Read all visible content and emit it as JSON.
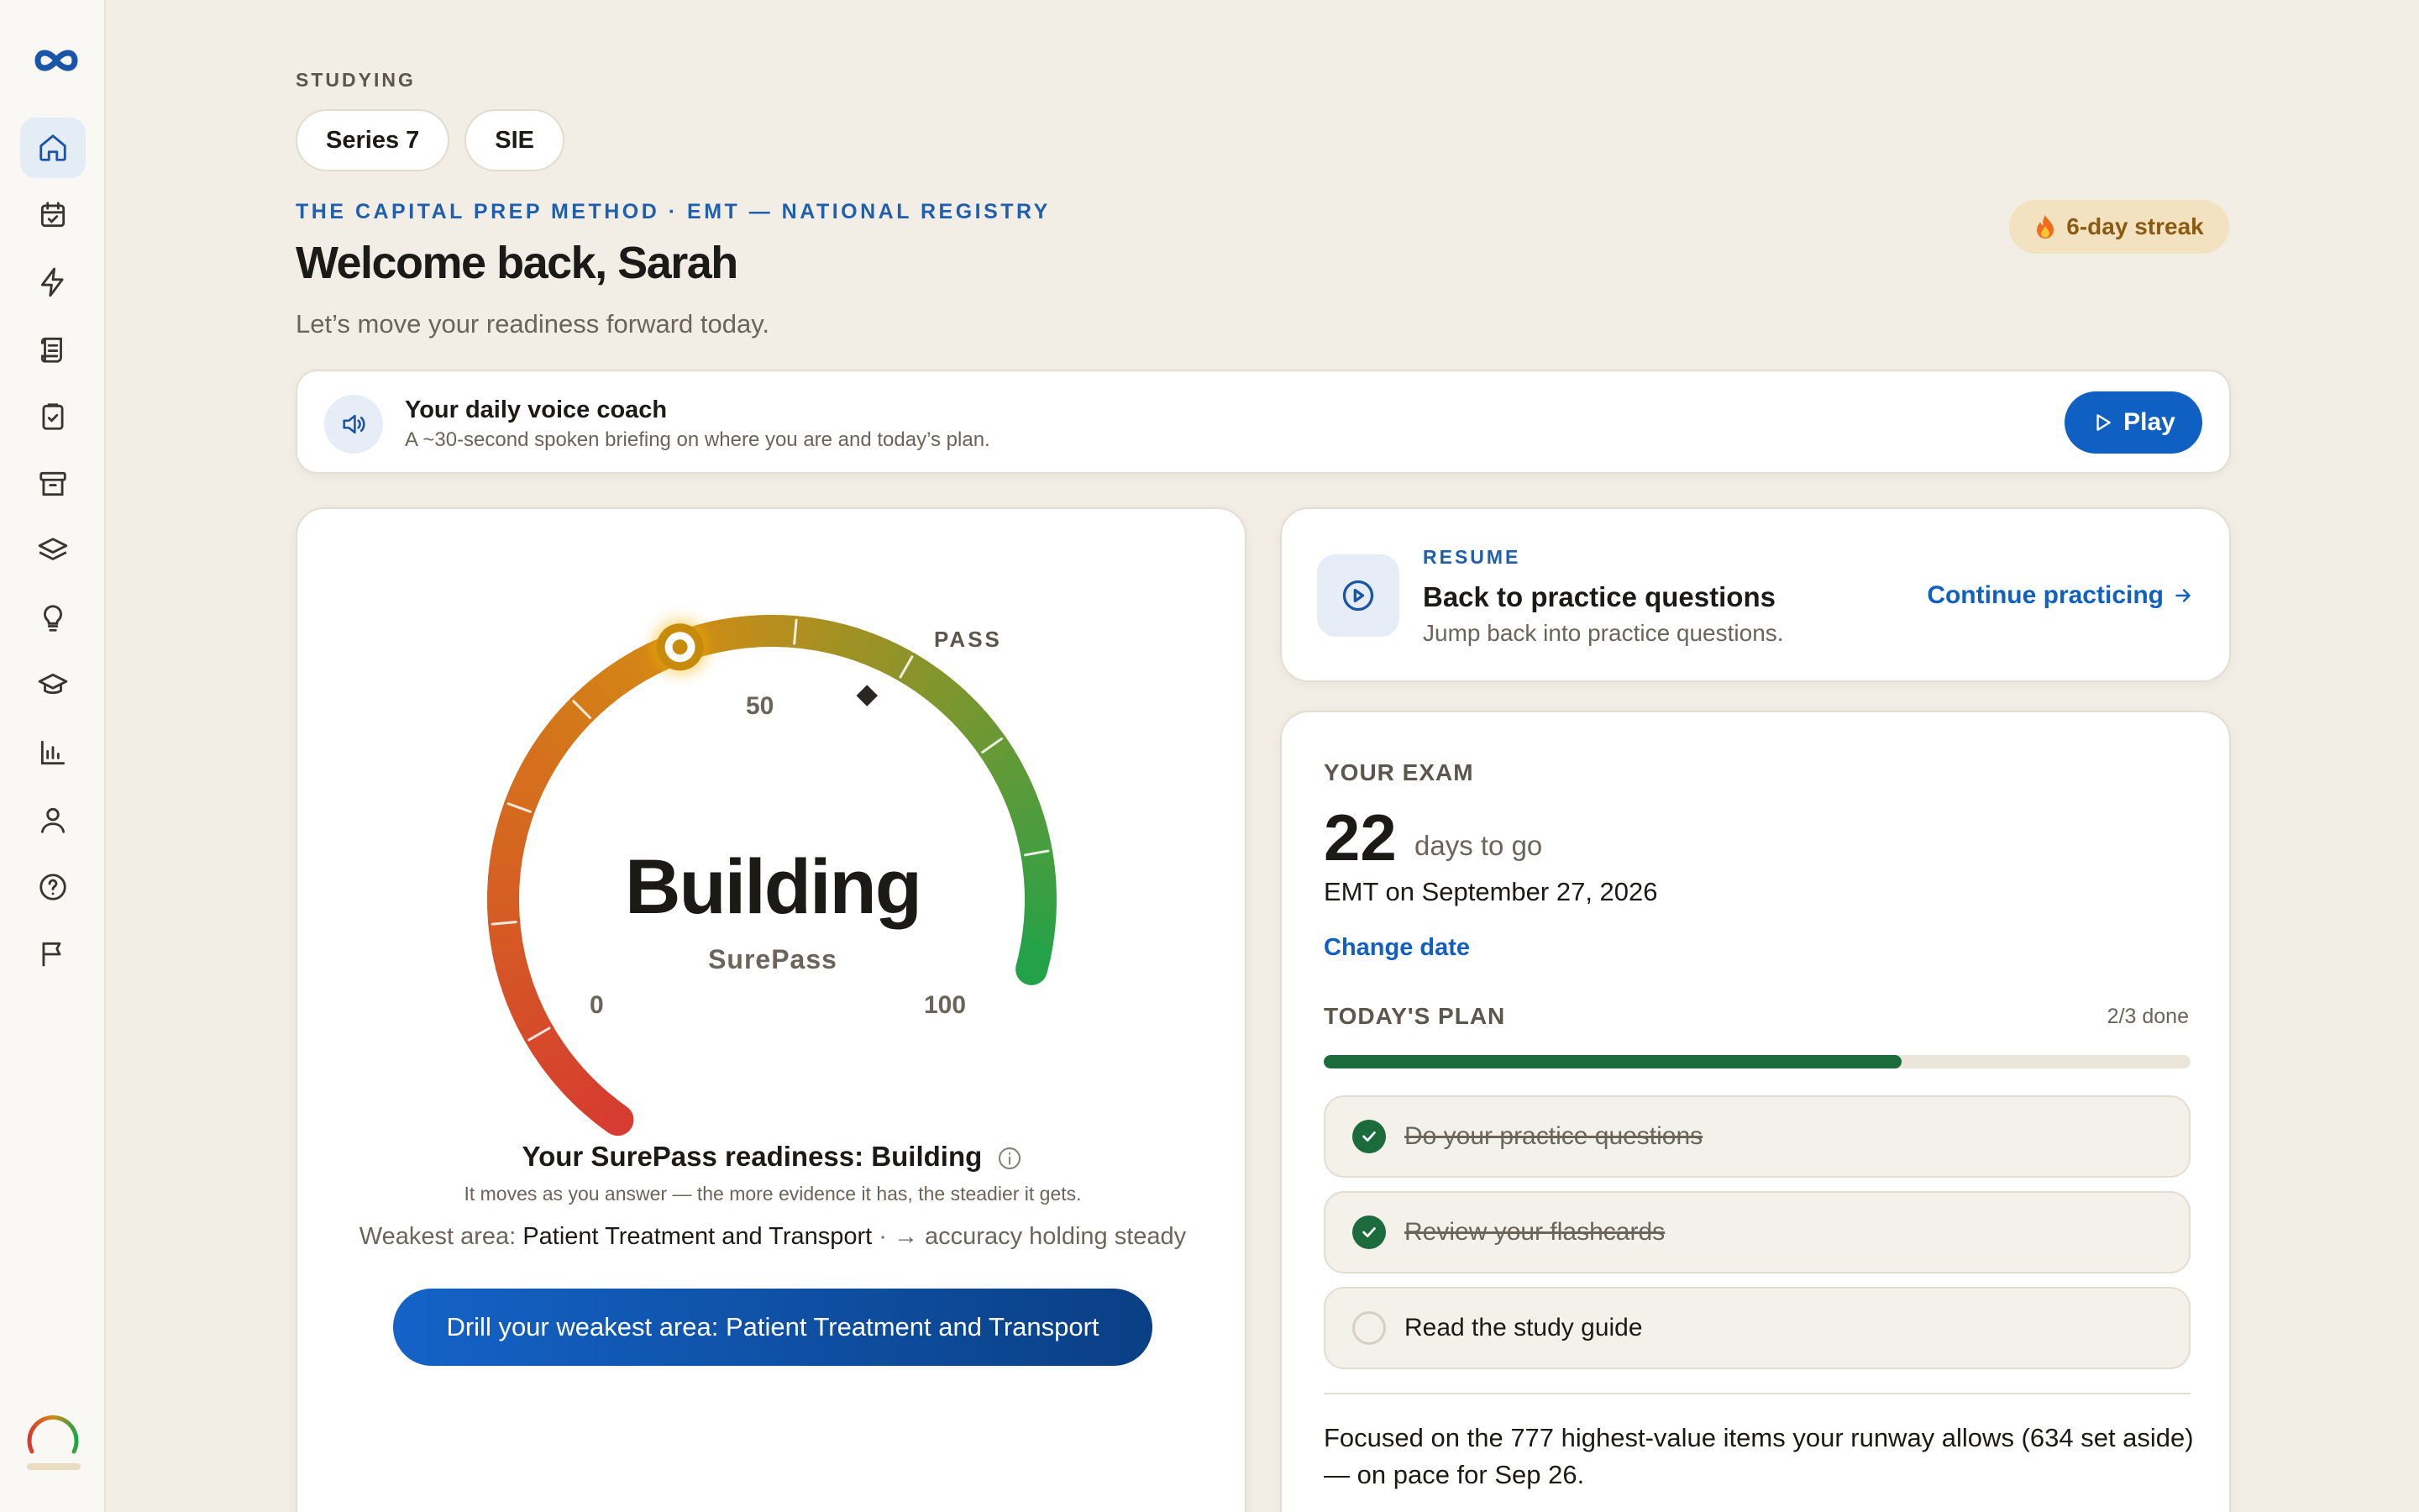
{
  "sidebar": {
    "logo_icon": "infinity-logo-icon",
    "items": [
      {
        "icon": "home-icon",
        "active": true
      },
      {
        "icon": "calendar-check-icon",
        "active": false
      },
      {
        "icon": "lightning-icon",
        "active": false
      },
      {
        "icon": "scroll-icon",
        "active": false
      },
      {
        "icon": "clipboard-check-icon",
        "active": false
      },
      {
        "icon": "archive-icon",
        "active": false
      },
      {
        "icon": "layers-icon",
        "active": false
      },
      {
        "icon": "lightbulb-icon",
        "active": false
      },
      {
        "icon": "graduation-cap-icon",
        "active": false
      },
      {
        "icon": "bar-chart-icon",
        "active": false
      },
      {
        "icon": "user-icon",
        "active": false
      },
      {
        "icon": "help-circle-icon",
        "active": false
      },
      {
        "icon": "flag-icon",
        "active": false
      }
    ]
  },
  "header": {
    "studying_label": "STUDYING",
    "exams": [
      "Series 7",
      "SIE"
    ],
    "method_line": "THE CAPITAL PREP METHOD · EMT — NATIONAL REGISTRY",
    "welcome": "Welcome back, Sarah",
    "subtitle": "Let’s move your readiness forward today.",
    "streak": "6-day streak",
    "streak_icon": "fire-icon"
  },
  "voice_coach": {
    "title": "Your daily voice coach",
    "description": "A ~30-second spoken briefing on where you are and today’s plan.",
    "play_label": "Play"
  },
  "gauge": {
    "status_word": "Building",
    "brand": "SurePass",
    "min_label": "0",
    "mid_label": "50",
    "max_label": "100",
    "pass_label": "PASS",
    "value": 50,
    "pass_value": 68,
    "readiness_prefix": "Your SurePass readiness:",
    "readiness_value": "Building",
    "readiness_note": "It moves as you answer — the more evidence it has, the steadier it gets.",
    "weakest_prefix": "Weakest area:",
    "weakest_area": "Patient Treatment and Transport",
    "weakest_trend": "· → accuracy holding steady",
    "drill_label": "Drill your weakest area: Patient Treatment and Transport",
    "colors": {
      "low": "#d63b2f",
      "mid": "#d48a14",
      "high": "#22a24a"
    }
  },
  "resume": {
    "kicker": "RESUME",
    "title": "Back to practice questions",
    "description": "Jump back into practice questions.",
    "link": "Continue practicing"
  },
  "exam": {
    "kicker": "YOUR EXAM",
    "days": "22",
    "days_label": "days to go",
    "date_line": "EMT on September 27, 2026",
    "change_date": "Change date"
  },
  "plan": {
    "kicker": "TODAY'S PLAN",
    "done_label": "2/3 done",
    "progress": 0.667,
    "items": [
      {
        "label": "Do your practice questions",
        "done": true
      },
      {
        "label": "Review your flashcards",
        "done": true
      },
      {
        "label": "Read the study guide",
        "done": false
      }
    ],
    "focus_note": "Focused on the 777 highest-value items your runway allows (634 set aside) — on pace for Sep 26."
  }
}
